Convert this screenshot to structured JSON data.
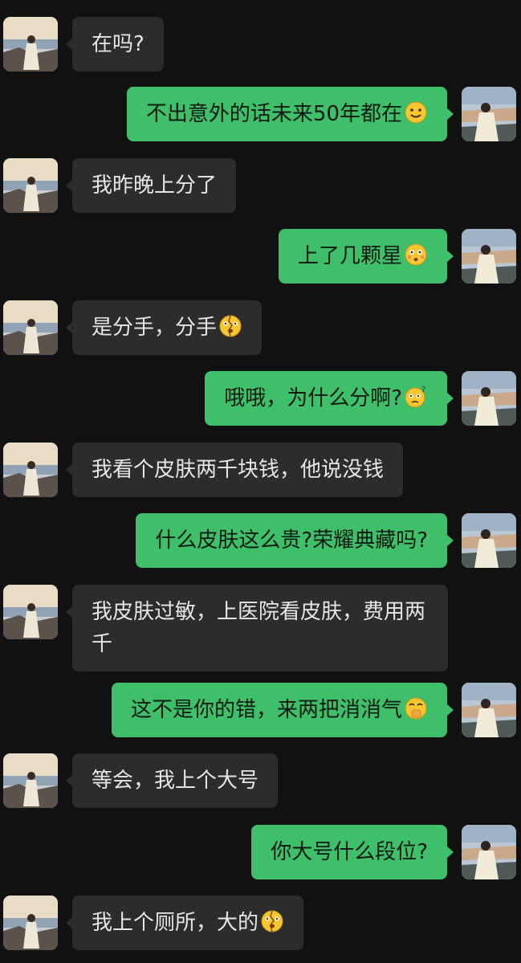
{
  "conversation": {
    "messages": [
      {
        "side": "in",
        "text": "在吗?",
        "emoji": ""
      },
      {
        "side": "out",
        "text": "不出意外的话未来50年都在",
        "emoji": "smile-emoji-icon"
      },
      {
        "side": "in",
        "text": "我昨晚上分了",
        "emoji": ""
      },
      {
        "side": "out",
        "text": "上了几颗星",
        "emoji": "flushed-emoji-icon"
      },
      {
        "side": "in",
        "text": "是分手，分手",
        "emoji": "broken-face-emoji-icon"
      },
      {
        "side": "out",
        "text": "哦哦，为什么分啊?",
        "emoji": "confused-emoji-icon"
      },
      {
        "side": "in",
        "text": "我看个皮肤两千块钱，他说没钱",
        "emoji": ""
      },
      {
        "side": "out",
        "text": "什么皮肤这么贵?荣耀典藏吗?",
        "emoji": ""
      },
      {
        "side": "in",
        "text": "我皮肤过敏，上医院看皮肤，费用两千",
        "emoji": ""
      },
      {
        "side": "out",
        "text": "这不是你的错，来两把消消气",
        "emoji": "hand-over-mouth-emoji-icon"
      },
      {
        "side": "in",
        "text": "等会，我上个大号",
        "emoji": ""
      },
      {
        "side": "out",
        "text": "你大号什么段位?",
        "emoji": ""
      },
      {
        "side": "in",
        "text": "我上个厕所，大的",
        "emoji": "broken-face-emoji-icon"
      }
    ]
  },
  "colors": {
    "background": "#111111",
    "incoming_bubble": "#2c2c2c",
    "outgoing_bubble": "#3fbf69"
  }
}
